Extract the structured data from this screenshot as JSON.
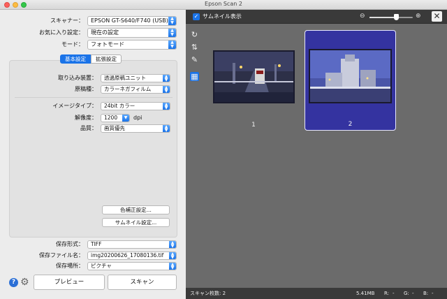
{
  "window": {
    "title": "Epson Scan 2"
  },
  "form": {
    "scanner": {
      "label": "スキャナー：",
      "value": "EPSON GT-S640/F740 (USB)"
    },
    "favorite": {
      "label": "お気に入り設定：",
      "value": "現在の設定"
    },
    "mode": {
      "label": "モード：",
      "value": "フォトモード"
    }
  },
  "tabs": {
    "basic": "基本設定",
    "advanced": "拡張設定"
  },
  "basic": {
    "source": {
      "label": "取り込み装置：",
      "value": "透過原稿ユニット"
    },
    "doc_type": {
      "label": "原稿種：",
      "value": "カラーネガフィルム"
    },
    "image_type": {
      "label": "イメージタイプ：",
      "value": "24bit カラー"
    },
    "resolution": {
      "label": "解像度：",
      "value": "1200",
      "unit": "dpi"
    },
    "quality": {
      "label": "品質：",
      "value": "画質優先"
    },
    "color_correction_button": "色補正設定...",
    "thumbnail_settings_button": "サムネイル設定..."
  },
  "save": {
    "format": {
      "label": "保存形式：",
      "value": "TIFF"
    },
    "filename": {
      "label": "保存ファイル名：",
      "value": "img20200626_17080136.tif"
    },
    "location": {
      "label": "保存場所：",
      "value": "ピクチャ"
    }
  },
  "bottom": {
    "help_icon": "?",
    "preview_button": "プレビュー",
    "scan_button": "スキャン"
  },
  "preview": {
    "thumbnail_toggle": {
      "label": "サムネイル表示",
      "checked": true
    },
    "zoom_level": 0.62,
    "thumbnails": [
      {
        "number": "1",
        "selected": false
      },
      {
        "number": "2",
        "selected": true
      }
    ]
  },
  "status": {
    "scan_count": "スキャン枚数: 2",
    "file_size": "5.41MB",
    "r_label": "R:",
    "r_value": "-",
    "g_label": "G:",
    "g_value": "-",
    "b_label": "B:",
    "b_value": "-"
  },
  "icons": {
    "rotate": "rotate-icon",
    "flip": "flip-icon",
    "auto_exposure": "auto-exposure-icon",
    "image_mode": "image-mode-icon",
    "help": "help-icon",
    "settings": "gear-icon",
    "close": "close-icon"
  },
  "colors": {
    "accent": "#1a73e8",
    "selected_thumb": "#3433a0"
  }
}
